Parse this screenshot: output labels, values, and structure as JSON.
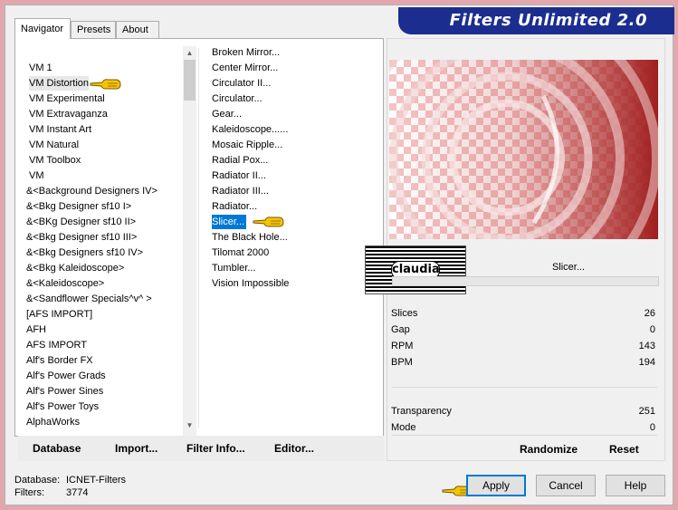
{
  "window": {
    "title": "Filters Unlimited 2.0"
  },
  "tabs": [
    {
      "label": "Navigator",
      "active": true
    },
    {
      "label": "Presets",
      "active": false
    },
    {
      "label": "About",
      "active": false
    }
  ],
  "categories": [
    "VM 1",
    "VM Distortion",
    "VM Experimental",
    "VM Extravaganza",
    "VM Instant Art",
    "VM Natural",
    "VM Toolbox",
    "VM",
    "&<Background Designers IV>",
    "&<Bkg Designer sf10 I>",
    "&<BKg Designer sf10 II>",
    "&<Bkg Designer sf10 III>",
    "&<Bkg Designers sf10 IV>",
    "&<Bkg Kaleidoscope>",
    "&<Kaleidoscope>",
    "&<Sandflower Specials^v^ >",
    "[AFS IMPORT]",
    "AFH",
    "AFS IMPORT",
    "Alf's Border FX",
    "Alf's Power Grads",
    "Alf's Power Sines",
    "Alf's Power Toys",
    "AlphaWorks"
  ],
  "selected_category": "VM Distortion",
  "filters": [
    "Broken Mirror...",
    "Center Mirror...",
    "Circulator II...",
    "Circulator...",
    "Gear...",
    "Kaleidoscope......",
    "Mosaic Ripple...",
    "Radial Pox...",
    "Radiator II...",
    "Radiator III...",
    "Radiator...",
    "Slicer...",
    "The Black Hole...",
    "Tilomat 2000",
    "Tumbler...",
    "Vision Impossible"
  ],
  "selected_filter": "Slicer...",
  "left_buttons": {
    "database": "Database",
    "import": "Import...",
    "filter_info": "Filter Info...",
    "editor": "Editor..."
  },
  "watermark": {
    "text": "claudia"
  },
  "filter_name": "Slicer...",
  "params": [
    {
      "label": "Slices",
      "value": "26"
    },
    {
      "label": "Gap",
      "value": "0"
    },
    {
      "label": "RPM",
      "value": "143"
    },
    {
      "label": "BPM",
      "value": "194"
    },
    {
      "label": "Transparency",
      "value": "251"
    },
    {
      "label": "Mode",
      "value": "0"
    }
  ],
  "right_buttons": {
    "randomize": "Randomize",
    "reset": "Reset"
  },
  "status": {
    "database_label": "Database:",
    "database_value": "ICNET-Filters",
    "filters_label": "Filters:",
    "filters_value": "3774"
  },
  "dialog_buttons": {
    "apply": "Apply",
    "cancel": "Cancel",
    "help": "Help"
  },
  "colors": {
    "title_banner": "#1b2d8f",
    "selection": "#0078d7",
    "preview_red": "#b52a2a",
    "pointer": "#f5c400"
  }
}
